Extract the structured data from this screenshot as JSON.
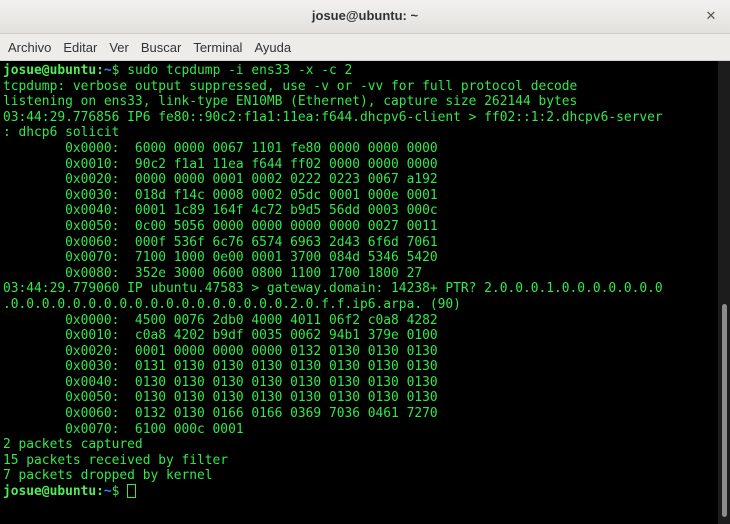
{
  "window": {
    "title": "josue@ubuntu: ~",
    "close_glyph": "✕"
  },
  "menu": [
    "Archivo",
    "Editar",
    "Ver",
    "Buscar",
    "Terminal",
    "Ayuda"
  ],
  "terminal": {
    "prompt_user": "josue@ubuntu",
    "prompt_sep": ":",
    "prompt_path": "~",
    "prompt_symbol": "$ ",
    "command": "sudo tcpdump -i ens33 -x -c 2",
    "output": [
      "tcpdump: verbose output suppressed, use -v or -vv for full protocol decode",
      "listening on ens33, link-type EN10MB (Ethernet), capture size 262144 bytes",
      "03:44:29.776856 IP6 fe80::90c2:f1a1:11ea:f644.dhcpv6-client > ff02::1:2.dhcpv6-server",
      ": dhcp6 solicit",
      "\t0x0000:  6000 0000 0067 1101 fe80 0000 0000 0000",
      "\t0x0010:  90c2 f1a1 11ea f644 ff02 0000 0000 0000",
      "\t0x0020:  0000 0000 0001 0002 0222 0223 0067 a192",
      "\t0x0030:  018d f14c 0008 0002 05dc 0001 000e 0001",
      "\t0x0040:  0001 1c89 164f 4c72 b9d5 56dd 0003 000c",
      "\t0x0050:  0c00 5056 0000 0000 0000 0000 0027 0011",
      "\t0x0060:  000f 536f 6c76 6574 6963 2d43 6f6d 7061",
      "\t0x0070:  7100 1000 0e00 0001 3700 084d 5346 5420",
      "\t0x0080:  352e 3000 0600 0800 1100 1700 1800 27",
      "03:44:29.779060 IP ubuntu.47583 > gateway.domain: 14238+ PTR? 2.0.0.0.1.0.0.0.0.0.0.0",
      ".0.0.0.0.0.0.0.0.0.0.0.0.0.0.0.0.0.0.2.0.f.f.ip6.arpa. (90)",
      "\t0x0000:  4500 0076 2db0 4000 4011 06f2 c0a8 4282",
      "\t0x0010:  c0a8 4202 b9df 0035 0062 94b1 379e 0100",
      "\t0x0020:  0001 0000 0000 0000 0132 0130 0130 0130",
      "\t0x0030:  0131 0130 0130 0130 0130 0130 0130 0130",
      "\t0x0040:  0130 0130 0130 0130 0130 0130 0130 0130",
      "\t0x0050:  0130 0130 0130 0130 0130 0130 0130 0130",
      "\t0x0060:  0132 0130 0166 0166 0369 7036 0461 7270",
      "\t0x0070:  6100 000c 0001",
      "2 packets captured",
      "15 packets received by filter",
      "7 packets dropped by kernel"
    ]
  }
}
